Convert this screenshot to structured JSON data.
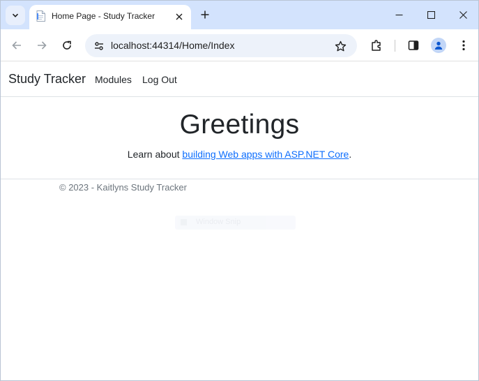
{
  "browser": {
    "tab_title": "Home Page - Study Tracker",
    "url": "localhost:44314/Home/Index"
  },
  "site": {
    "brand": "Study Tracker",
    "nav": [
      {
        "label": "Modules"
      },
      {
        "label": "Log Out"
      }
    ]
  },
  "main": {
    "heading": "Greetings",
    "intro_prefix": "Learn about ",
    "intro_link": "building Web apps with ASP.NET Core",
    "intro_suffix": "."
  },
  "footer": {
    "text": "© 2023 - Kaitlyns Study Tracker"
  },
  "overlay": {
    "snap_label": "Window Snip"
  },
  "colors": {
    "tabstrip": "#d3e3fd",
    "link": "#0d6efd",
    "omnibox": "#edf2fa"
  }
}
